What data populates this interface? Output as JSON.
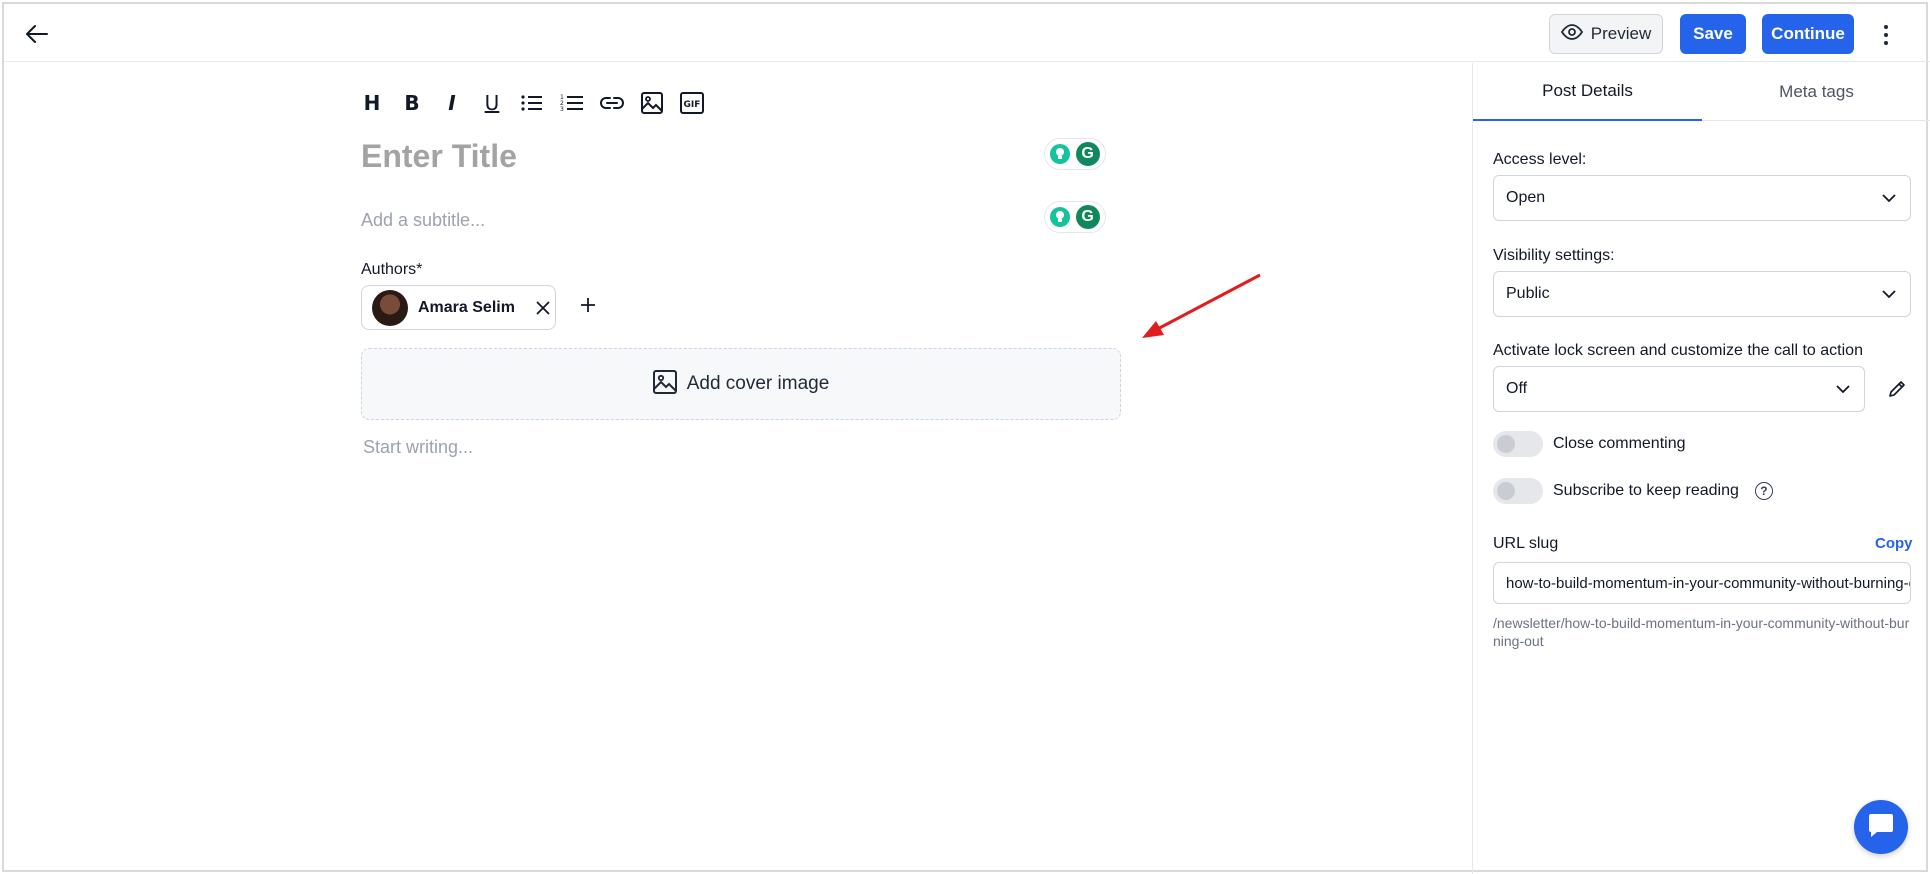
{
  "header": {
    "preview_label": "Preview",
    "save_label": "Save",
    "continue_label": "Continue"
  },
  "toolbar": {
    "heading": "H",
    "bold": "B",
    "italic": "I",
    "underline": "U",
    "gif": "GIF"
  },
  "editor": {
    "title_placeholder": "Enter Title",
    "subtitle_placeholder": "Add a subtitle...",
    "authors_label": "Authors*",
    "author_name": "Amara Selim",
    "cover_label": "Add cover image",
    "body_placeholder": "Start writing..."
  },
  "grammarly": {
    "letter": "G"
  },
  "panel": {
    "tabs": [
      "Post Details",
      "Meta tags"
    ],
    "access_label": "Access level:",
    "access_value": "Open",
    "visibility_label": "Visibility settings:",
    "visibility_value": "Public",
    "lock_label": "Activate lock screen and customize the call to action",
    "lock_value": "Off",
    "close_commenting_label": "Close commenting",
    "close_commenting_on": false,
    "subscribe_label": "Subscribe to keep reading",
    "help_glyph": "?",
    "slug_label": "URL slug",
    "copy_label": "Copy",
    "slug_value": "how-to-build-momentum-in-your-community-without-burning-out",
    "slug_path": "/newsletter/how-to-build-momentum-in-your-community-without-burning-out"
  },
  "colors": {
    "accent": "#2563eb",
    "annotation_arrow": "#e11d1d",
    "grammarly_green": "#11875e"
  }
}
